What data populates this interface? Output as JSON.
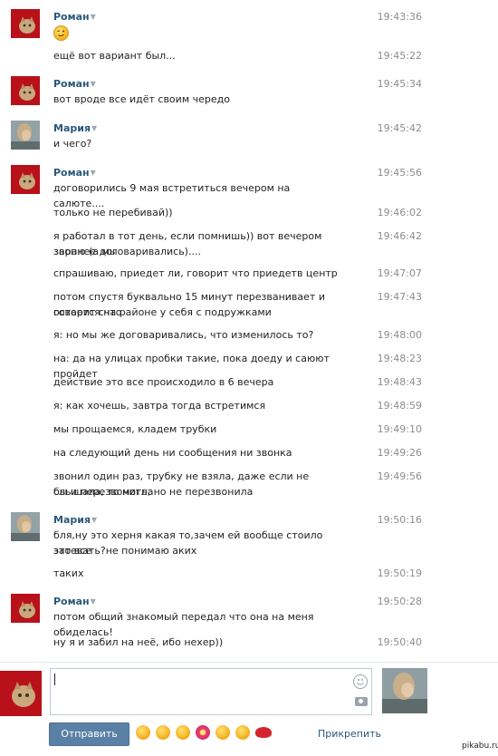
{
  "messages": [
    {
      "author": "Роман",
      "time": "19:43:36",
      "emoji": "wink",
      "lines": []
    },
    {
      "author": null,
      "time": "19:45:22",
      "lines": [
        "ещё вот вариант был..."
      ]
    },
    {
      "author": "Роман",
      "time": "19:45:34",
      "lines": [
        "вот вроде все идёт своим чередо"
      ]
    },
    {
      "author": "Мария",
      "time": "19:45:42",
      "lines": [
        "и чего?"
      ]
    },
    {
      "author": "Роман",
      "time": "19:45:56",
      "lines": [
        "договорились 9 мая встретиться вечером на салюте...."
      ]
    },
    {
      "author": null,
      "time": "19:46:02",
      "lines": [
        "только не перебивай))"
      ]
    },
    {
      "author": null,
      "time": "19:46:42",
      "lines": [
        "я работал в тот день, если помнишь)) вот вечером звоню (а мы",
        "заранее договаривались)...."
      ]
    },
    {
      "author": null,
      "time": "19:47:07",
      "lines": [
        "спрашиваю, приедет ли, говорит что приедетв центр"
      ]
    },
    {
      "author": null,
      "time": "19:47:43",
      "lines": [
        "потом спустя буквально 15 минут перезванивает и говорит счто",
        "остается на районе у себя с подружками"
      ]
    },
    {
      "author": null,
      "time": "19:48:00",
      "lines": [
        "я: но мы же договаривались, что изменилось то?"
      ]
    },
    {
      "author": null,
      "time": "19:48:23",
      "lines": [
        "на: да на улицах пробки такие, пока доеду и саюют пройдет"
      ]
    },
    {
      "author": null,
      "time": "19:48:43",
      "lines": [
        "действие это все происходило в 6 вечера"
      ]
    },
    {
      "author": null,
      "time": "19:48:59",
      "lines": [
        "я: как хочешь, завтра тогда встретимся"
      ]
    },
    {
      "author": null,
      "time": "19:49:10",
      "lines": [
        "мы прощаемся, кладем трубки"
      ]
    },
    {
      "author": null,
      "time": "19:49:26",
      "lines": [
        "на следующий день ни сообщения ни звонка"
      ]
    },
    {
      "author": null,
      "time": "19:49:56",
      "lines": [
        "звонил один раз, трубку не взяла, даже если не слышала, то могла",
        "бы и перезвонить, но не перезвонила"
      ]
    },
    {
      "author": "Мария",
      "time": "19:50:16",
      "lines": [
        "бля,ну это херня какая то,зачем ей вообще стоило это все",
        "затевать?не понимаю аких"
      ]
    },
    {
      "author": null,
      "time": "19:50:19",
      "lines": [
        "таких"
      ]
    },
    {
      "author": "Роман",
      "time": "19:50:28",
      "lines": [
        "потом общий знакомый передал что она на меня обиделась!"
      ]
    },
    {
      "author": null,
      "time": "19:50:40",
      "lines": [
        "ну я и забил на неё, ибо нехер))"
      ]
    }
  ],
  "compose": {
    "send_label": "Отправить",
    "attach_label": "Прикрепить",
    "watermark": "pikabu.ru",
    "smiles": [
      "smile",
      "laugh",
      "grin",
      "flower",
      "blush",
      "sleep",
      "kiss"
    ]
  },
  "colors": {
    "author": "#2b587a",
    "time": "#8d8d8d",
    "button": "#5b80a6"
  }
}
